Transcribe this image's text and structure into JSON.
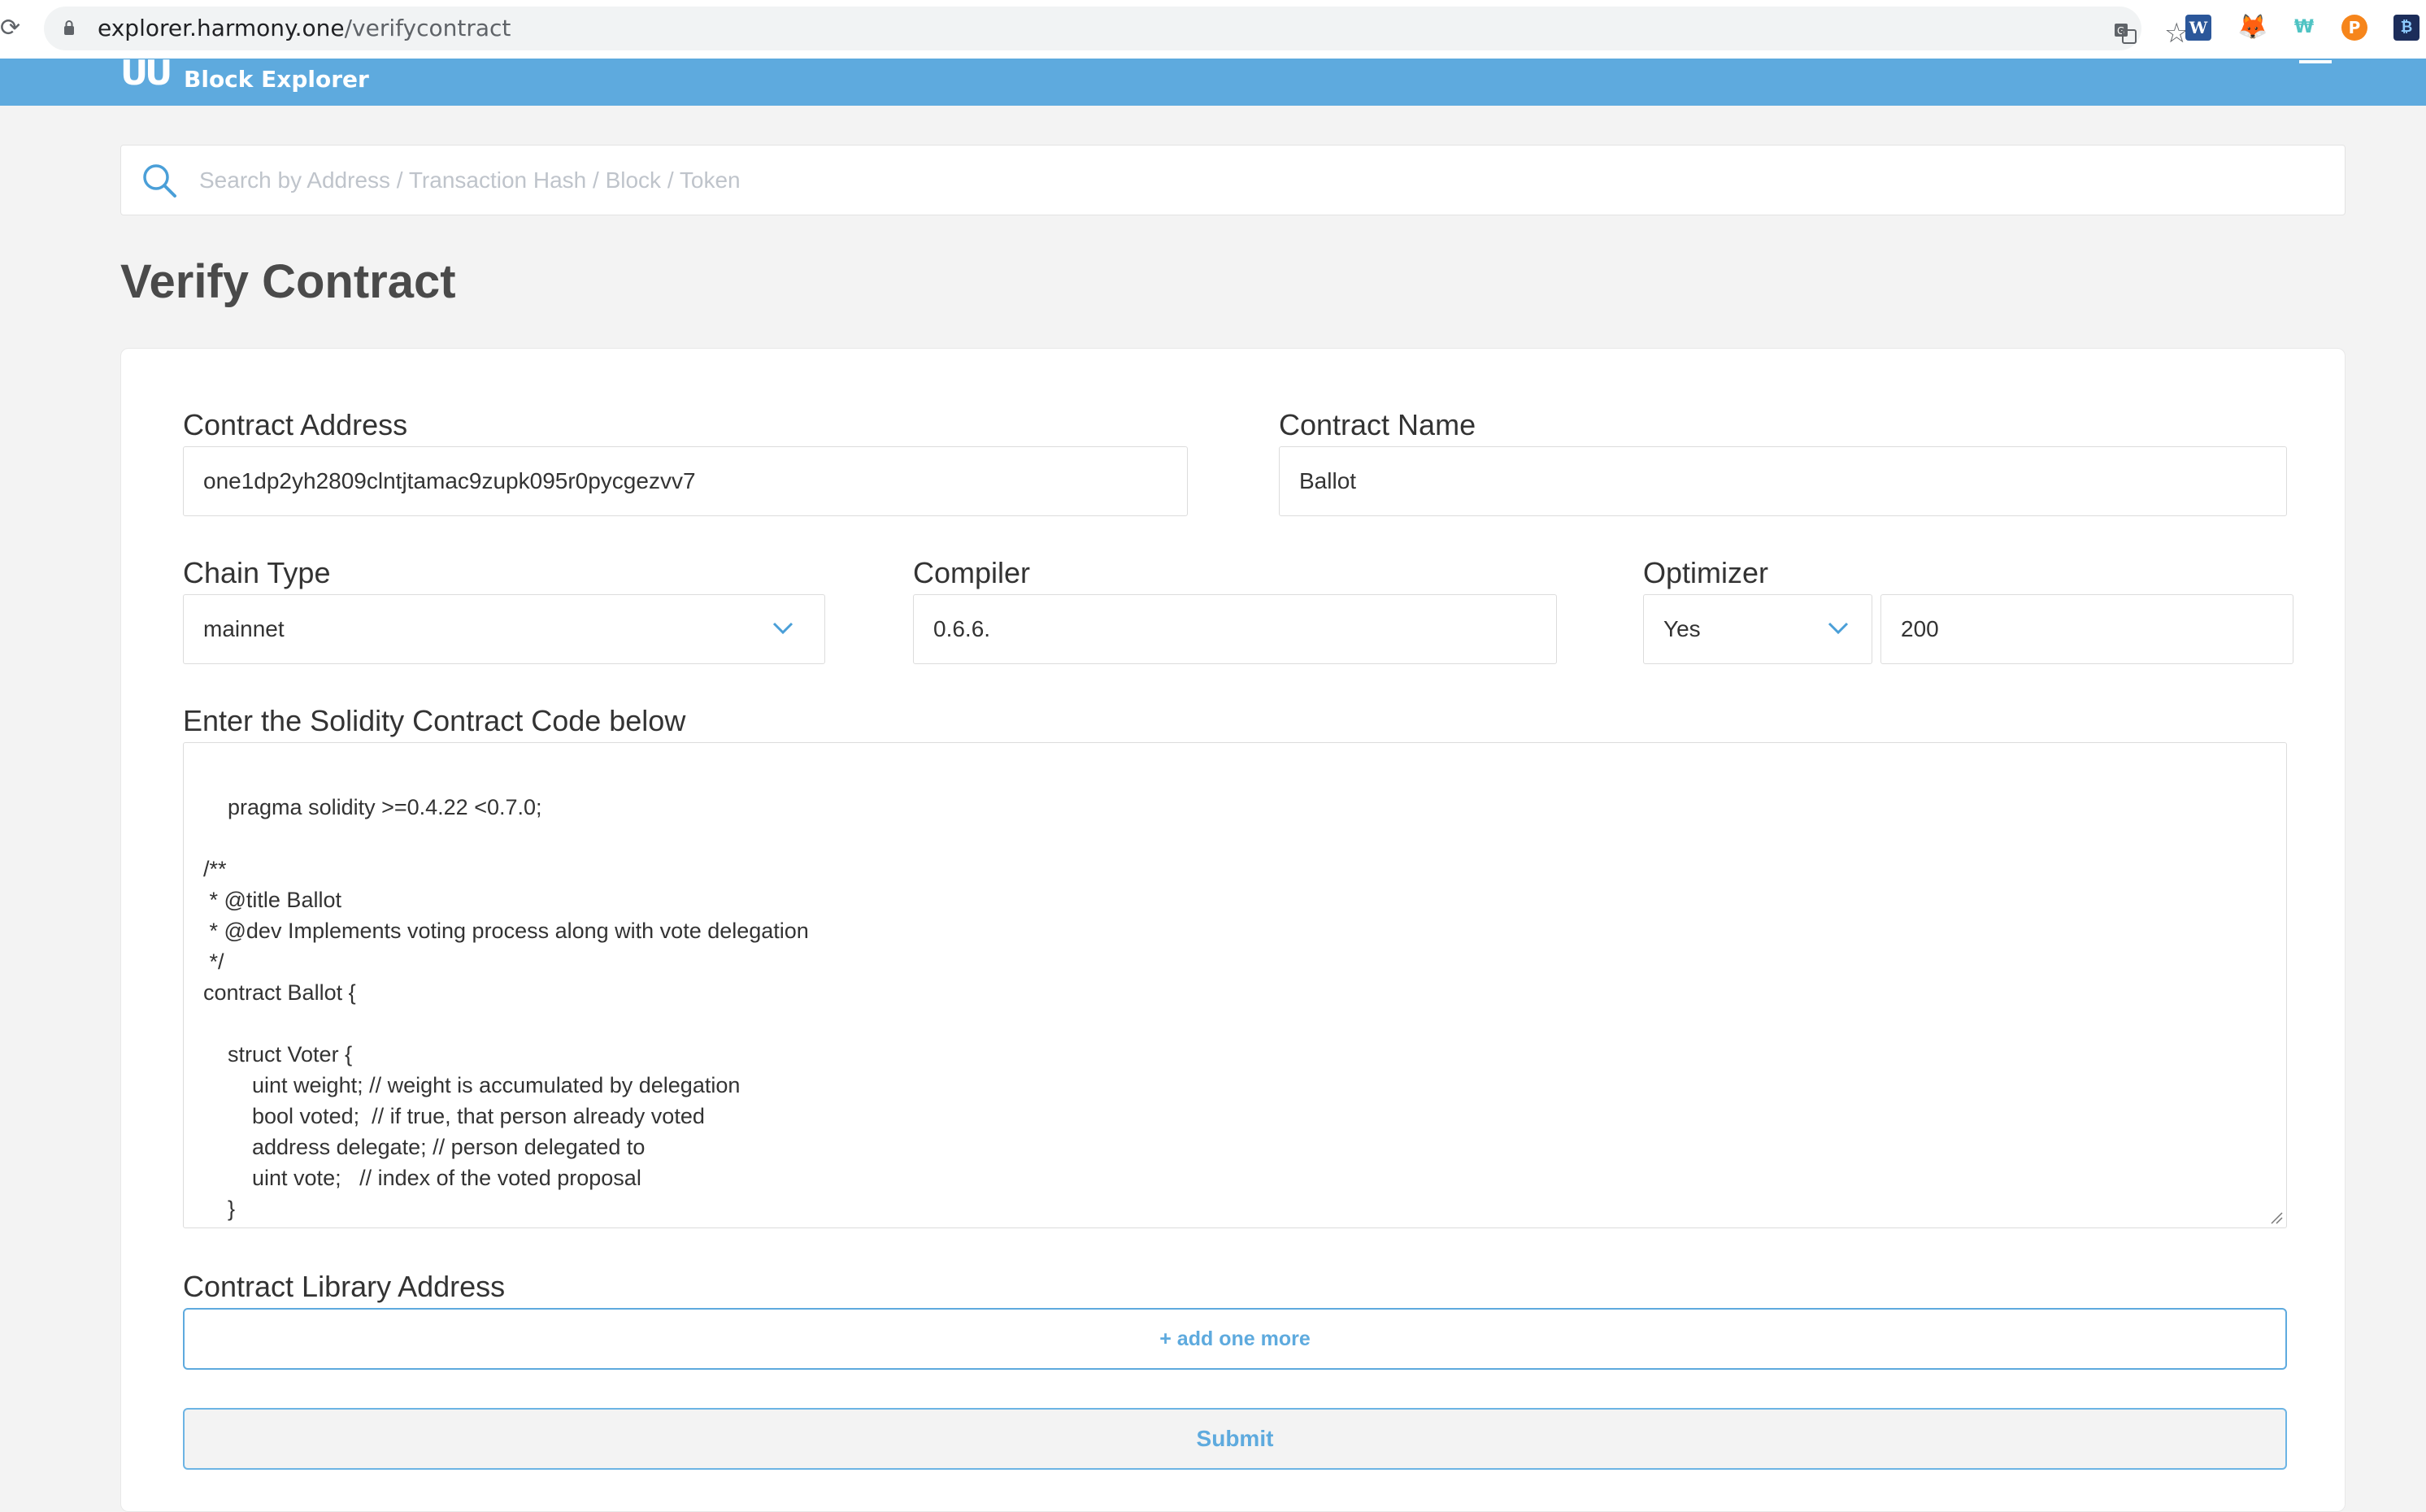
{
  "browser": {
    "url_host": "explorer.harmony.one",
    "url_path": "/verifycontract"
  },
  "header": {
    "logo_text": "Block Explorer"
  },
  "search": {
    "placeholder": "Search by Address / Transaction Hash / Block / Token",
    "value": ""
  },
  "page": {
    "title": "Verify Contract"
  },
  "form": {
    "contract_address": {
      "label": "Contract Address",
      "value": "one1dp2yh2809clntjtamac9zupk095r0pycgezvv7"
    },
    "contract_name": {
      "label": "Contract Name",
      "value": "Ballot"
    },
    "chain_type": {
      "label": "Chain Type",
      "value": "mainnet"
    },
    "compiler": {
      "label": "Compiler",
      "value": "0.6.6."
    },
    "optimizer": {
      "label": "Optimizer",
      "value": "Yes",
      "runs": "200"
    },
    "source_code": {
      "label": "Enter the Solidity Contract Code below",
      "value": "pragma solidity >=0.4.22 <0.7.0;\n\n/**\n * @title Ballot\n * @dev Implements voting process along with vote delegation\n */\ncontract Ballot {\n\n    struct Voter {\n        uint weight; // weight is accumulated by delegation\n        bool voted;  // if true, that person already voted\n        address delegate; // person delegated to\n        uint vote;   // index of the voted proposal\n    }"
    },
    "library": {
      "label": "Contract Library Address",
      "add_label": "+ add one more"
    },
    "submit_label": "Submit"
  },
  "colors": {
    "header_bg": "#5eaade",
    "accent": "#5eaade",
    "page_bg": "#f3f3f3"
  },
  "icons": [
    "reload-icon",
    "lock-icon",
    "translate-icon",
    "star-icon",
    "search-icon",
    "chevron-down-icon",
    "menu-icon"
  ]
}
